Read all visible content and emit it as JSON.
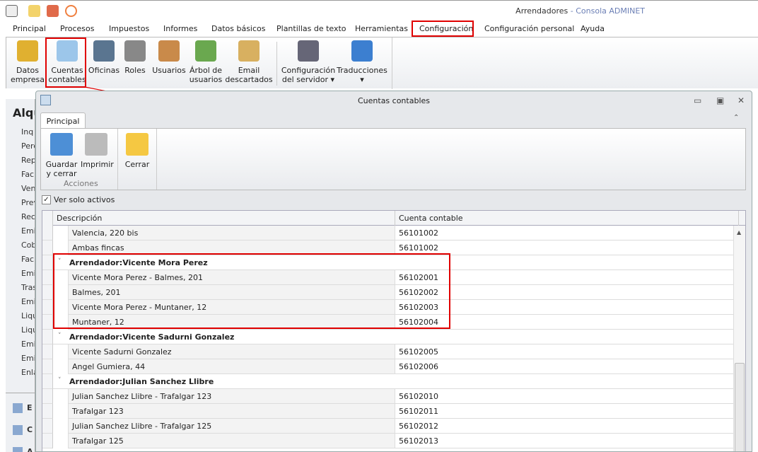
{
  "window": {
    "title": "Arrendadores",
    "title_sep": " - ",
    "app": "Consola ADMINET"
  },
  "menu_tabs": [
    "Principal",
    "Procesos",
    "Impuestos",
    "Informes",
    "Datos básicos",
    "Plantillas de texto",
    "Herramientas",
    "Configuración",
    "Configuración personal",
    "Ayuda"
  ],
  "ribbon": [
    {
      "label": "Datos\nempresa",
      "icon": "database-icon"
    },
    {
      "label": "Cuentas\ncontables",
      "icon": "accounts-icon"
    },
    {
      "label": "Oficinas",
      "icon": "offices-icon"
    },
    {
      "label": "Roles",
      "icon": "lock-icon"
    },
    {
      "label": "Usuarios",
      "icon": "users-icon"
    },
    {
      "label": "Árbol de\nusuarios",
      "icon": "tree-icon"
    },
    {
      "label": "Email\ndescartados",
      "icon": "email-blocked-icon"
    },
    {
      "label": "Configuración\ndel servidor ▾",
      "icon": "tools-icon"
    },
    {
      "label": "Traducciones\n▾",
      "icon": "translate-icon"
    }
  ],
  "sidebar": {
    "heading": "Alqu",
    "items": [
      "Inq",
      "Perc",
      "Rep",
      "Fac",
      "Ven",
      "Prev",
      "Rec",
      "Emis",
      "Cob",
      "Fac",
      "Emis",
      "Tras",
      "Emis",
      "Liqu",
      "Liqu",
      "Emis",
      "Emis",
      "Enla"
    ],
    "bottom": [
      "E",
      "C",
      "A"
    ]
  },
  "dialog": {
    "title": "Cuentas contables",
    "tab": "Principal",
    "actions": [
      {
        "label": "Guardar\ny cerrar",
        "icon": "save-icon"
      },
      {
        "label": "Imprimir",
        "icon": "printer-icon"
      },
      {
        "label": "Cerrar",
        "icon": "folder-close-icon"
      }
    ],
    "group_label": "Acciones",
    "checkbox": {
      "label": "Ver solo activos",
      "checked": true
    },
    "columns": [
      "Descripción",
      "Cuenta contable"
    ],
    "rows": [
      {
        "type": "row",
        "desc": "Valencia, 220 bis",
        "cuenta": "56101002"
      },
      {
        "type": "row",
        "desc": "Ambas fincas",
        "cuenta": "56101002"
      },
      {
        "type": "group",
        "desc": "Arrendador:Vicente Mora Perez"
      },
      {
        "type": "row",
        "desc": "Vicente Mora Perez - Balmes, 201",
        "cuenta": "56102001"
      },
      {
        "type": "row",
        "desc": "Balmes, 201",
        "cuenta": "56102002"
      },
      {
        "type": "row",
        "desc": "Vicente Mora Perez - Muntaner, 12",
        "cuenta": "56102003"
      },
      {
        "type": "row",
        "desc": "Muntaner, 12",
        "cuenta": "56102004"
      },
      {
        "type": "group",
        "desc": "Arrendador:Vicente Sadurni Gonzalez"
      },
      {
        "type": "row",
        "desc": "Vicente Sadurni Gonzalez",
        "cuenta": "56102005"
      },
      {
        "type": "row",
        "desc": "Angel Gumiera, 44",
        "cuenta": "56102006"
      },
      {
        "type": "group",
        "desc": "Arrendador:Julian Sanchez Llibre"
      },
      {
        "type": "row",
        "desc": "Julian Sanchez Llibre - Trafalgar 123",
        "cuenta": "56102010"
      },
      {
        "type": "row",
        "desc": "Trafalgar 123",
        "cuenta": "56102011"
      },
      {
        "type": "row",
        "desc": "Julian Sanchez Llibre - Trafalgar 125",
        "cuenta": "56102012"
      },
      {
        "type": "row",
        "desc": "Trafalgar 125",
        "cuenta": "56102013"
      }
    ]
  }
}
